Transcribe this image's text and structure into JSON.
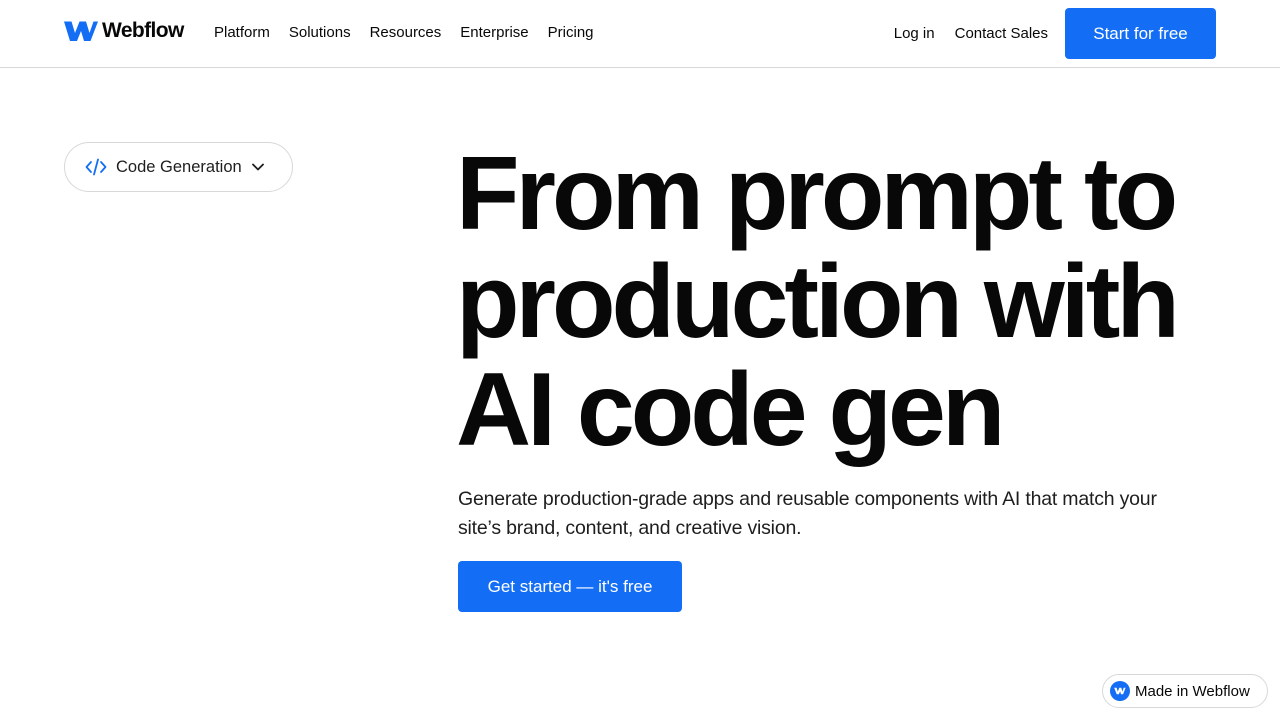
{
  "nav": {
    "brand": "Webflow",
    "brand_icon": "webflow-logo-icon",
    "links": [
      "Platform",
      "Solutions",
      "Resources",
      "Enterprise",
      "Pricing"
    ],
    "login": "Log in",
    "contact": "Contact Sales",
    "cta": "Start for free"
  },
  "category": {
    "label": "Code Generation",
    "icon": "code-icon",
    "chevron": "chevron-down-icon"
  },
  "hero": {
    "title_lines": [
      "From prompt to",
      "production with",
      "AI code gen"
    ],
    "subtitle": "Generate production-grade apps and reusable components with AI that match your site’s brand, content, and creative vision.",
    "cta": "Get started — it's free"
  },
  "badge": {
    "label": "Made in Webflow",
    "icon": "webflow-badge-icon"
  },
  "colors": {
    "accent": "#146ef5",
    "text": "#080808",
    "border": "#d8d8d8"
  }
}
